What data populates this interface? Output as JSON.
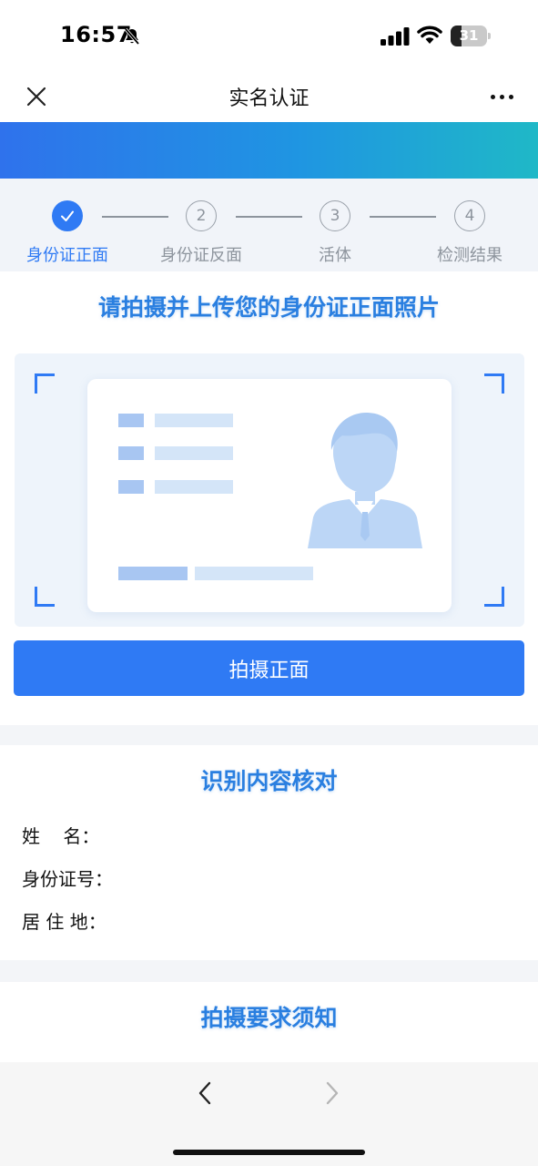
{
  "status_bar": {
    "time": "16:57",
    "battery_level": "31",
    "battery_fraction": 0.31
  },
  "nav": {
    "title": "实名认证"
  },
  "steps": [
    {
      "number": "1",
      "label": "身份证正面",
      "state": "done"
    },
    {
      "number": "2",
      "label": "身份证反面",
      "state": "todo"
    },
    {
      "number": "3",
      "label": "活体",
      "state": "todo"
    },
    {
      "number": "4",
      "label": "检测结果",
      "state": "todo"
    }
  ],
  "upload": {
    "heading": "请拍摄并上传您的身份证正面照片",
    "button_label": "拍摄正面"
  },
  "verify": {
    "heading": "识别内容核对",
    "fields": [
      {
        "label": "姓    名：",
        "value": ""
      },
      {
        "label": "身份证号：",
        "value": ""
      },
      {
        "label": "居 住 地：",
        "value": ""
      }
    ]
  },
  "requirements": {
    "heading": "拍摄要求须知"
  },
  "icons": {
    "close": "close-icon",
    "more": "more-icon",
    "back": "chevron-left-icon",
    "forward": "chevron-right-icon",
    "check": "check-icon",
    "silent": "bell-slash-icon"
  },
  "colors": {
    "primary": "#2f7af4",
    "heading": "#2a7fe0",
    "muted": "#8d949d"
  }
}
